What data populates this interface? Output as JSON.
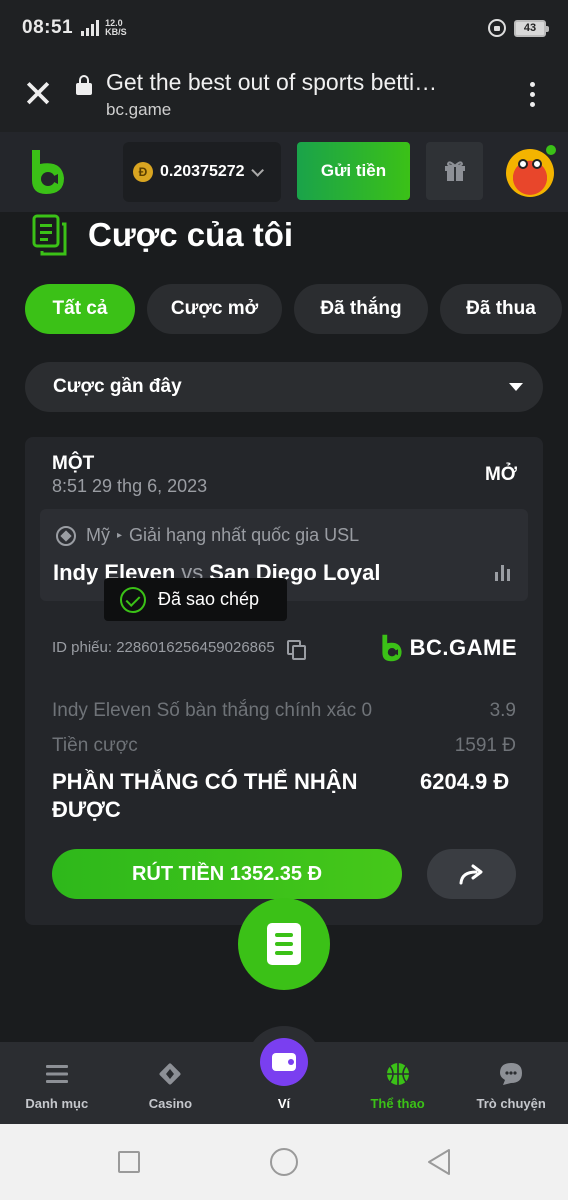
{
  "status_bar": {
    "time": "08:51",
    "network": "4G",
    "speed_value": "12.0",
    "speed_unit": "KB/S",
    "battery": "43"
  },
  "browser": {
    "page_title": "Get the best out of sports betti…",
    "domain": "bc.game"
  },
  "header": {
    "coin_symbol": "Đ",
    "balance": "0.20375272",
    "deposit_label": "Gửi tiền"
  },
  "page": {
    "title": "Cược của tôi"
  },
  "tabs": [
    {
      "label": "Tất cả",
      "active": true
    },
    {
      "label": "Cược mở",
      "active": false
    },
    {
      "label": "Đã thắng",
      "active": false
    },
    {
      "label": "Đã thua",
      "active": false
    }
  ],
  "filter": {
    "selected": "Cược gần đây"
  },
  "bet": {
    "type": "MỘT",
    "datetime": "8:51 29 thg 6, 2023",
    "status": "MỞ",
    "country": "Mỹ",
    "league": "Giải hạng nhất quốc gia USL",
    "home": "Indy Eleven",
    "vs": "vs",
    "away": "San Diego Loyal",
    "ticket_id_label": "ID phiếu: 2286016256459026865",
    "brand": "BC.GAME",
    "selection": "Indy Eleven Số bàn thắng chính xác 0",
    "odds": "3.9",
    "stake_label": "Tiền cược",
    "stake_value": "1591 Đ",
    "payout_label": "PHẦN THẮNG CÓ THỂ NHẬN ĐƯỢC",
    "payout_value": "6204.9 Đ",
    "cashout_label": "RÚT TIỀN 1352.35 Đ"
  },
  "toast": {
    "message": "Đã sao chép"
  },
  "bottom_nav": [
    {
      "label": "Danh mục",
      "icon": "menu-icon"
    },
    {
      "label": "Casino",
      "icon": "casino-icon"
    },
    {
      "label": "Ví",
      "icon": "wallet-icon"
    },
    {
      "label": "Thể thao",
      "icon": "basketball-icon",
      "active": true
    },
    {
      "label": "Trò chuyện",
      "icon": "chat-icon"
    }
  ],
  "colors": {
    "accent": "#3bc117",
    "background": "#1a1c1e",
    "card": "#24262a",
    "wallet": "#7a3ff0"
  }
}
